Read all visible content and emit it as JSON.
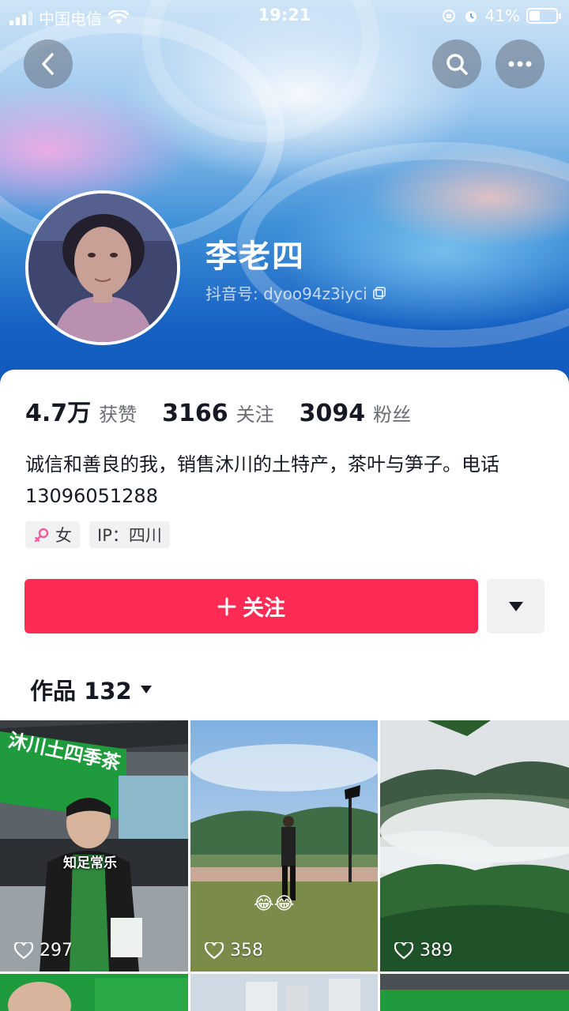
{
  "status_bar": {
    "carrier": "中国电信",
    "time": "19:21",
    "battery_percent": "41%",
    "battery_level": 0.41
  },
  "nav": {
    "back_icon": "chevron-left-icon",
    "search_icon": "search-icon",
    "more_icon": "more-dots-icon"
  },
  "profile": {
    "name": "李老四",
    "douyin_id": "抖音号: dyoo94z3iyci",
    "stats": [
      {
        "value": "4.7万",
        "label": "获赞"
      },
      {
        "value": "3166",
        "label": "关注"
      },
      {
        "value": "3094",
        "label": "粉丝"
      }
    ],
    "bio": "诚信和善良的我，销售沐川的土特产，茶叶与笋子。电话13096051288",
    "tags": {
      "gender": "女",
      "ip": "IP：四川"
    }
  },
  "actions": {
    "follow_label": "关注"
  },
  "works": {
    "header": "作品 132",
    "items": [
      {
        "likes": "297",
        "overlay_text": "知足常乐",
        "sign_text": "沐川土四季茶"
      },
      {
        "likes": "358",
        "overlay_text": "😂😂"
      },
      {
        "likes": "389"
      }
    ]
  },
  "colors": {
    "accent": "#fe2c55",
    "text_primary": "#161823",
    "text_secondary": "#6b6c73",
    "tag_bg": "#f1f1f2"
  }
}
